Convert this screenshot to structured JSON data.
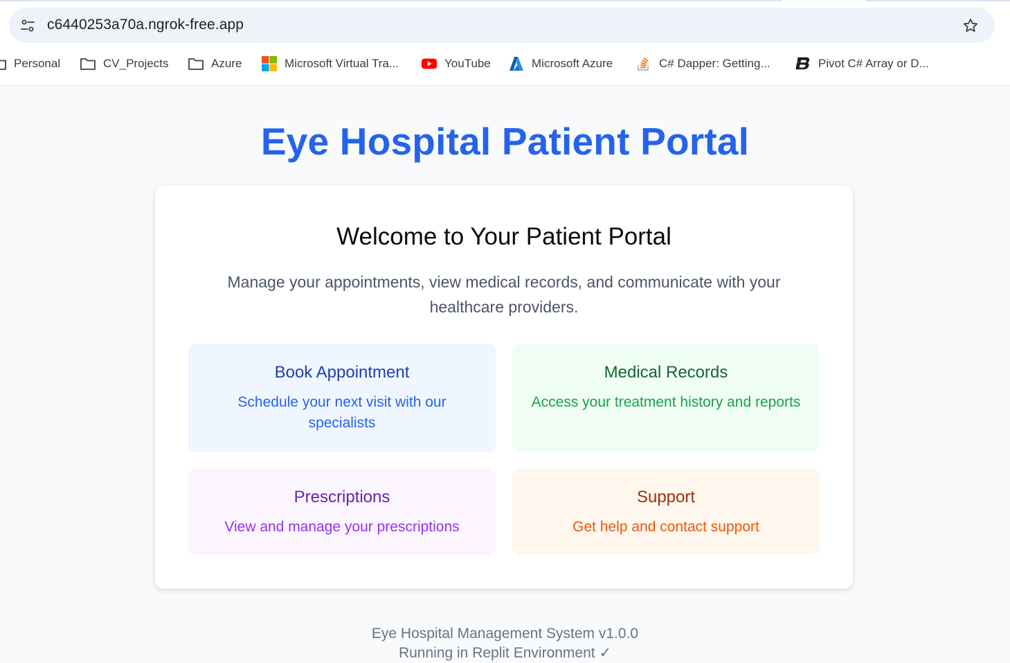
{
  "browser": {
    "url": "c6440253a70a.ngrok-free.app",
    "bookmarks": [
      {
        "label": "Personal",
        "icon": "folder-icon"
      },
      {
        "label": "CV_Projects",
        "icon": "folder-icon"
      },
      {
        "label": "Azure",
        "icon": "folder-icon"
      },
      {
        "label": "Microsoft Virtual Tra...",
        "icon": "microsoft-logo-icon"
      },
      {
        "label": "YouTube",
        "icon": "youtube-icon"
      },
      {
        "label": "Microsoft Azure",
        "icon": "azure-logo-icon"
      },
      {
        "label": "C# Dapper: Getting...",
        "icon": "stackoverflow-icon"
      },
      {
        "label": "Pivot C# Array or D...",
        "icon": "b-logo-icon"
      }
    ]
  },
  "page": {
    "title": "Eye Hospital Patient Portal",
    "welcome": {
      "heading": "Welcome to Your Patient Portal",
      "intro": "Manage your appointments, view medical records, and communicate with your healthcare providers."
    },
    "tiles": {
      "appointment": {
        "title": "Book Appointment",
        "desc": "Schedule your next visit with our specialists"
      },
      "records": {
        "title": "Medical Records",
        "desc": "Access your treatment history and reports"
      },
      "prescriptions": {
        "title": "Prescriptions",
        "desc": "View and manage your prescriptions"
      },
      "support": {
        "title": "Support",
        "desc": "Get help and contact support"
      }
    },
    "footer": {
      "line1": "Eye Hospital Management System v1.0.0",
      "line2": "Running in Replit Environment ✓"
    }
  },
  "colors": {
    "brand": "#2563eb",
    "page_bg": "#f8fafc",
    "appointment_bg": "#eff6ff",
    "records_bg": "#f0fdf4",
    "prescriptions_bg": "#faf5ff",
    "support_bg": "#fff7ed"
  }
}
